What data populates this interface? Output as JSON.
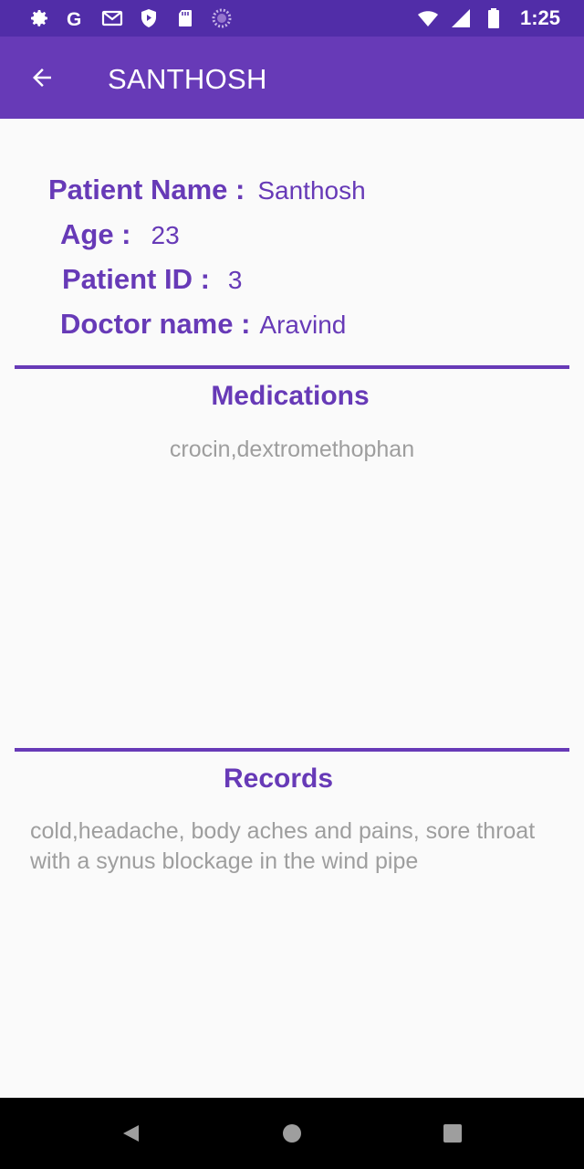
{
  "status_bar": {
    "time": "1:25",
    "left_icons": [
      "settings-icon",
      "google-icon",
      "gmail-icon",
      "shield-play-icon",
      "sd-card-icon",
      "sync-progress-icon"
    ],
    "right_icons": [
      "wifi-icon",
      "signal-icon",
      "battery-icon"
    ]
  },
  "app_bar": {
    "title": "SANTHOSH",
    "back_icon": "arrow-back-icon"
  },
  "patient": {
    "name_label": "Patient Name :",
    "name_value": "Santhosh",
    "age_label": "Age :",
    "age_value": "23",
    "id_label": "Patient ID :",
    "id_value": "3",
    "doctor_label": "Doctor name :",
    "doctor_value": "Aravind"
  },
  "medications": {
    "title": "Medications",
    "text": "crocin,dextromethophan"
  },
  "records": {
    "title": "Records",
    "text": "cold,headache, body aches and pains, sore throat with a synus blockage in the wind pipe"
  },
  "nav_bar": {
    "buttons": [
      "back-triangle-icon",
      "home-circle-icon",
      "recents-square-icon"
    ]
  },
  "colors": {
    "primary": "#673ab7",
    "primary_dark": "#512da8",
    "muted_text": "#9e9e9e",
    "background": "#fafafa"
  }
}
